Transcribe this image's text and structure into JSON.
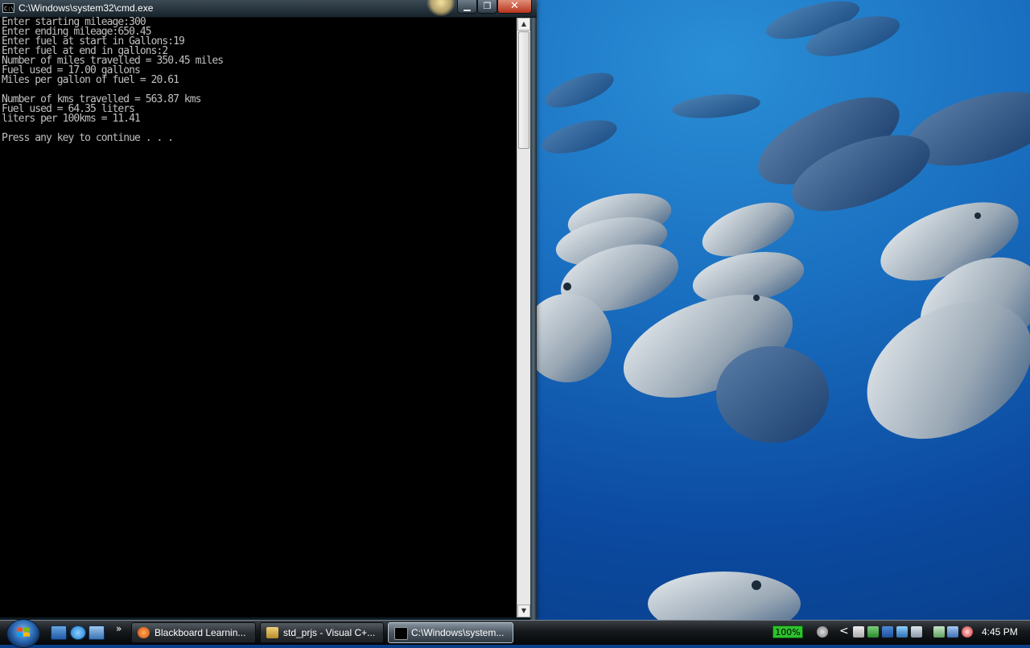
{
  "window": {
    "title": "C:\\Windows\\system32\\cmd.exe",
    "icon_label": "C:\\",
    "minimize_glyph": "▁",
    "maximize_glyph": "❐",
    "close_glyph": "✕"
  },
  "console": {
    "lines": [
      "Enter starting mileage:300",
      "Enter ending mileage:650.45",
      "Enter fuel at start in Gallons:19",
      "Enter fuel at end in gallons:2",
      "Number of miles travelled = 350.45 miles",
      "Fuel used = 17.00 gallons",
      "Miles per gallon of fuel = 20.61",
      "",
      "Number of kms travelled = 563.87 kms",
      "Fuel used = 64.35 liters",
      "liters per 100kms = 11.41",
      "",
      "Press any key to continue . . ."
    ],
    "text_color": "#c0c0c0",
    "background": "#000000"
  },
  "scrollbar": {
    "up_glyph": "▲",
    "down_glyph": "▼"
  },
  "taskbar": {
    "quicklaunch_more": "»",
    "tasks": [
      {
        "label": "Blackboard Learnin...",
        "icon": "firefox-icon",
        "active": false
      },
      {
        "label": "std_prjs - Visual C+...",
        "icon": "visual-studio-icon",
        "active": false
      },
      {
        "label": "C:\\Windows\\system...",
        "icon": "cmd-icon",
        "active": true
      }
    ],
    "tray": {
      "battery": "100%",
      "chevron": "<",
      "clock": "4:45 PM"
    }
  },
  "colors": {
    "wallpaper_blue": "#0b4aa0",
    "battery_green": "#2ec22e"
  }
}
